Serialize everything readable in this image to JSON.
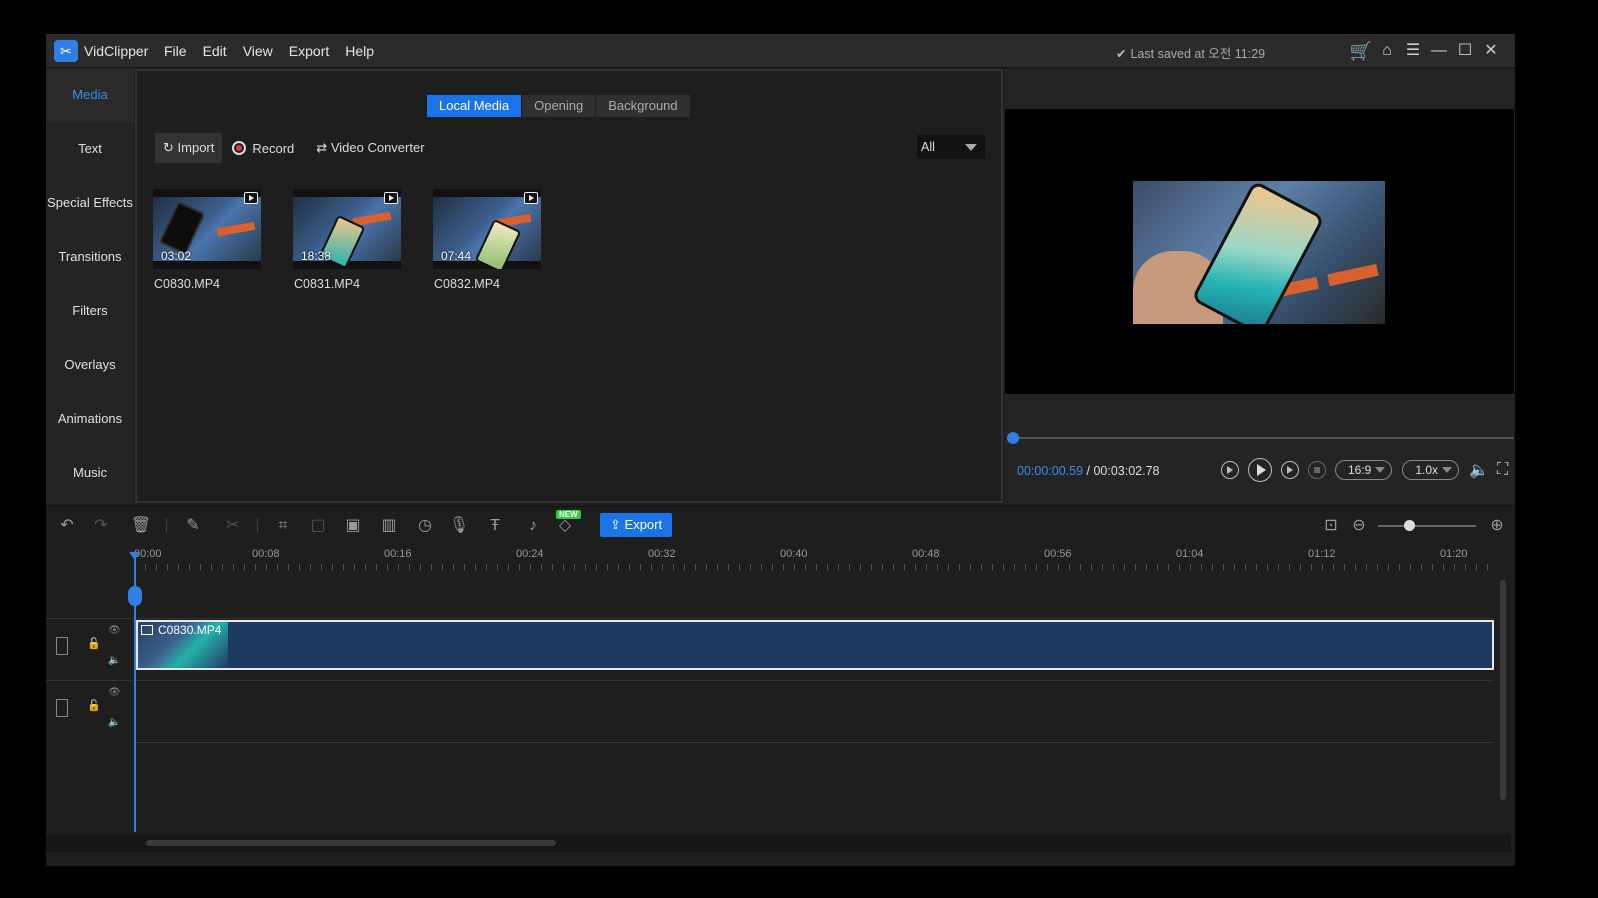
{
  "app": {
    "name": "VidClipper",
    "menu": [
      "File",
      "Edit",
      "View",
      "Export",
      "Help"
    ],
    "saved_status": "Last saved at 오전 11:29"
  },
  "leftnav": [
    "Media",
    "Text",
    "Special Effects",
    "Transitions",
    "Filters",
    "Overlays",
    "Animations",
    "Music"
  ],
  "media": {
    "tabs": [
      "Local Media",
      "Opening",
      "Background"
    ],
    "import_label": "Import",
    "record_label": "Record",
    "converter_label": "Video Converter",
    "filter_value": "All",
    "clips": [
      {
        "name": "C0830.MP4",
        "duration": "03:02"
      },
      {
        "name": "C0831.MP4",
        "duration": "18:38"
      },
      {
        "name": "C0832.MP4",
        "duration": "07:44"
      }
    ]
  },
  "preview": {
    "current_time": "00:00:00.59",
    "total_time": " / 00:03:02.78",
    "aspect": "16:9",
    "speed": "1.0x",
    "progress": 0.003
  },
  "toolbar": {
    "export_label": "Export",
    "new_badge": "NEW"
  },
  "timeline": {
    "ticks": [
      "00:00",
      "00:08",
      "00:16",
      "00:24",
      "00:32",
      "00:40",
      "00:48",
      "00:56",
      "01:04",
      "01:12",
      "01:20"
    ],
    "clip_name": "C0830.MP4"
  },
  "colors": {
    "accent": "#1a73e8",
    "clip_fill": "#1f3a61",
    "cart": "#f5b800"
  }
}
